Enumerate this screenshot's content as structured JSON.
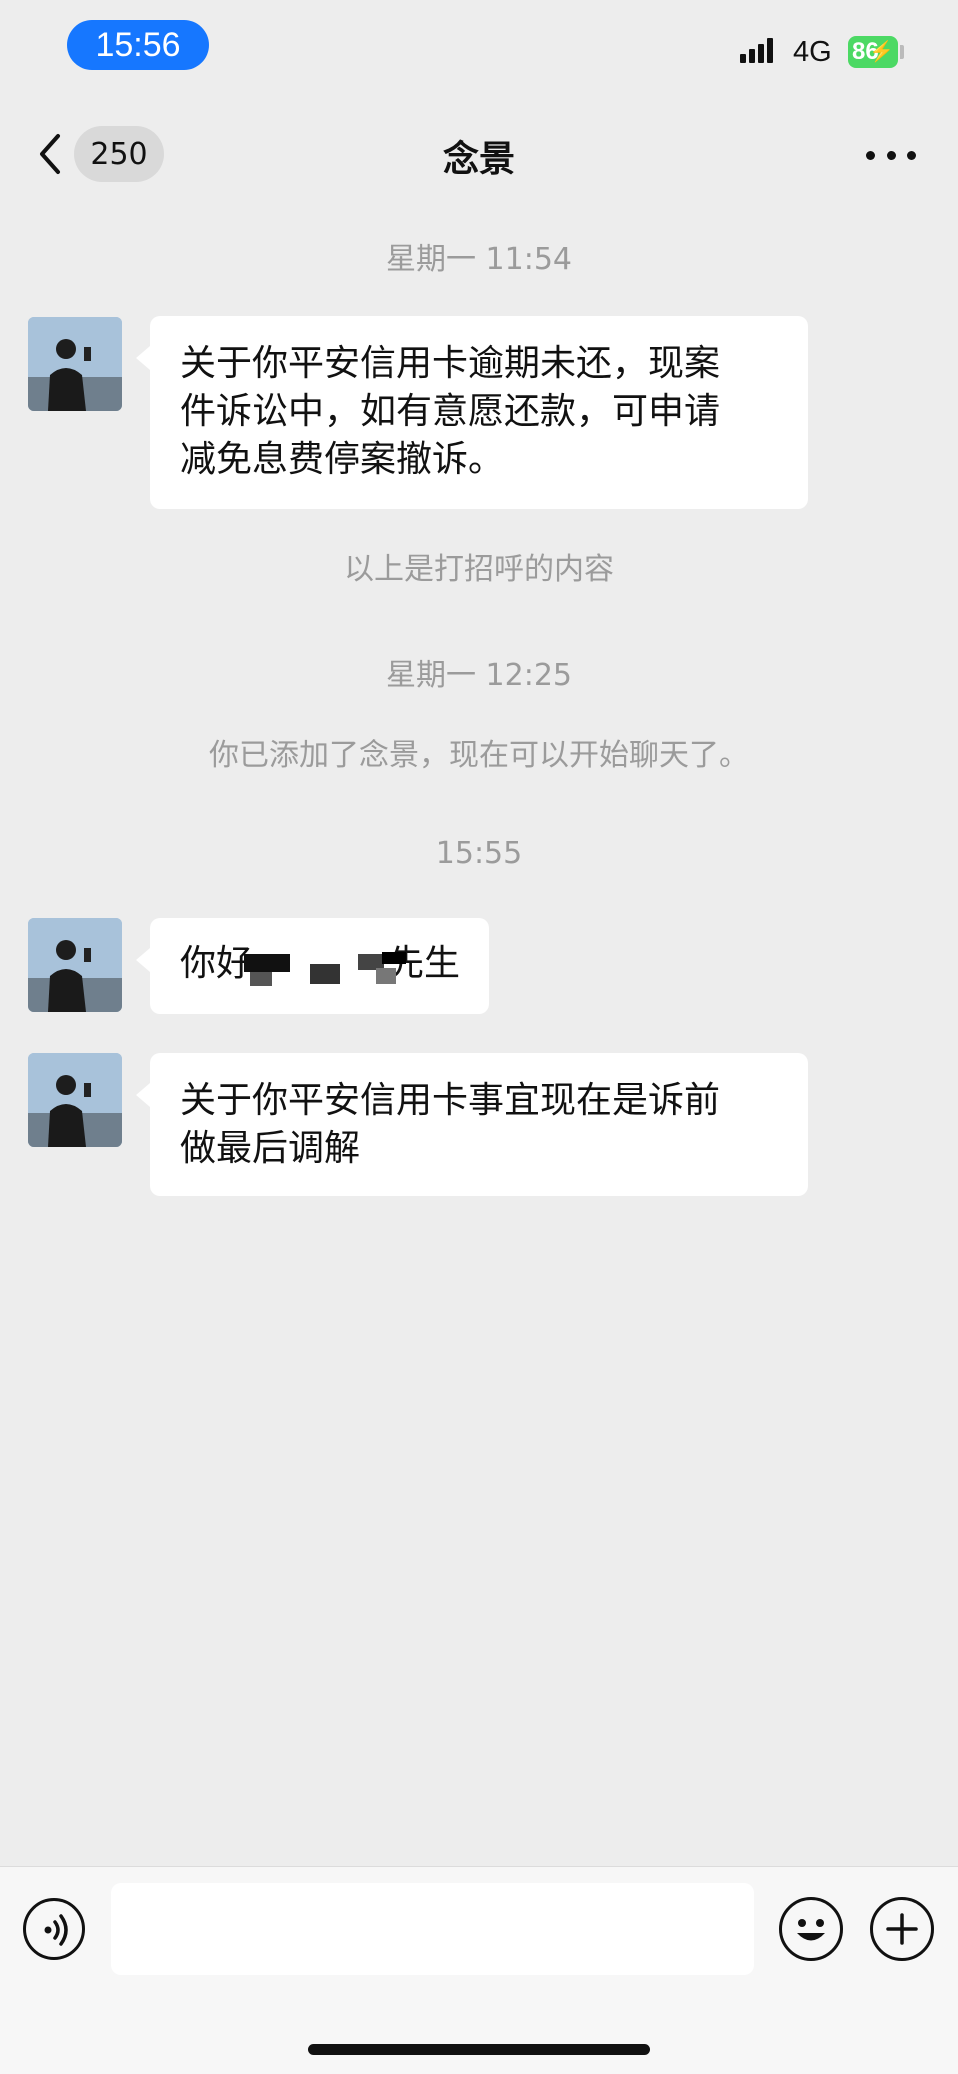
{
  "status_bar": {
    "time": "15:56",
    "network": "4G",
    "battery": "86",
    "icons": [
      "signal-icon",
      "battery-charging-icon"
    ]
  },
  "nav": {
    "unread_count": "250",
    "title": "念景",
    "icons": [
      "back-chevron-icon",
      "more-dots-icon"
    ]
  },
  "chat": {
    "items": [
      {
        "type": "timestamp",
        "text": "星期一 11:54"
      },
      {
        "type": "message",
        "lines": [
          "关于你平安信用卡逾期未还，现案",
          "件诉讼中，如有意愿还款，可申请",
          "减免息费停案撤诉。"
        ]
      },
      {
        "type": "system",
        "text": "以上是打招呼的内容"
      },
      {
        "type": "timestamp",
        "text": "星期一 12:25"
      },
      {
        "type": "system",
        "text": "你已添加了念景，现在可以开始聊天了。"
      },
      {
        "type": "timestamp",
        "text": "15:55"
      },
      {
        "type": "message",
        "text_start": "你好",
        "text_end": "先生",
        "redacted": true
      },
      {
        "type": "message",
        "lines": [
          "关于你平安信用卡事宜现在是诉前",
          "做最后调解"
        ]
      }
    ]
  },
  "input_bar": {
    "placeholder": "",
    "icons": [
      "voice-icon",
      "emoji-icon",
      "plus-icon"
    ]
  },
  "colors": {
    "background": "#ededed",
    "time_pill": "#1677ff",
    "battery": "#4cd964",
    "bubble": "#ffffff",
    "system_text": "#9b9b9b"
  }
}
